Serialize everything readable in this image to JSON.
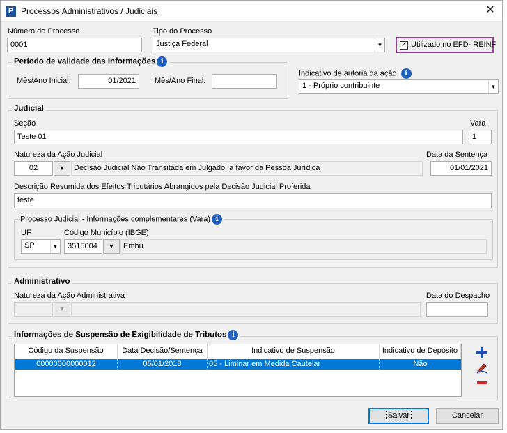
{
  "window": {
    "title": "Processos Administrativos / Judiciais",
    "close_glyph": "✕",
    "app_icon_letter": "P"
  },
  "top": {
    "numero_label": "Número do Processo",
    "numero_value": "0001",
    "tipo_label": "Tipo do Processo",
    "tipo_value": "Justiça Federal",
    "utilizado_label": "Utilizado no EFD- REINF",
    "utilizado_checked": true
  },
  "periodo": {
    "title": "Período de validade das Informações",
    "inicial_label": "Mês/Ano Inicial:",
    "inicial_value": "01/2021",
    "final_label": "Mês/Ano Final:",
    "final_value": ""
  },
  "autoria": {
    "label": "Indicativo de autoria da ação",
    "value": "1 - Próprio contribuinte"
  },
  "judicial": {
    "title": "Judicial",
    "secao_label": "Seção",
    "secao_value": "Teste 01",
    "vara_label": "Vara",
    "vara_value": "1",
    "natureza_label": "Natureza da Ação Judicial",
    "natureza_code": "02",
    "natureza_desc": "Decisão Judicial Não Transitada em Julgado, a favor da Pessoa Jurídica",
    "data_sentenca_label": "Data da Sentença",
    "data_sentenca_value": "01/01/2021",
    "descricao_label": "Descrição Resumida dos Efeitos Tributários Abrangidos pela Decisão Judicial Proferida",
    "descricao_value": "teste",
    "complementares_title": "Processo Judicial - Informações complementares (Vara)",
    "uf_label": "UF",
    "uf_value": "SP",
    "municipio_label": "Código Município (IBGE)",
    "municipio_code": "3515004",
    "municipio_name": "Embu"
  },
  "administrativo": {
    "title": "Administrativo",
    "natureza_label": "Natureza da Ação Administrativa",
    "natureza_code": "",
    "natureza_desc": "",
    "data_despacho_label": "Data do Despacho",
    "data_despacho_value": ""
  },
  "suspensao": {
    "title": "Informações de Suspensão de Exigibilidade de Tributos",
    "columns": [
      "Código da Suspensão",
      "Data Decisão/Sentença",
      "Indicativo de Suspensão",
      "Indicativo de Depósito"
    ],
    "rows": [
      {
        "codigo": "00000000000012",
        "data": "05/01/2018",
        "indicativo": "05 - Liminar em Medida Cautelar",
        "deposito": "Não"
      }
    ],
    "selected_row_color": "#0078d7"
  },
  "buttons": {
    "salvar": "Salvar",
    "cancelar": "Cancelar"
  },
  "colors": {
    "highlight_border": "#9b3ba0",
    "info_icon": "#1f5fbf",
    "add_icon": "#1f4fb5",
    "remove_icon": "#e02020"
  }
}
